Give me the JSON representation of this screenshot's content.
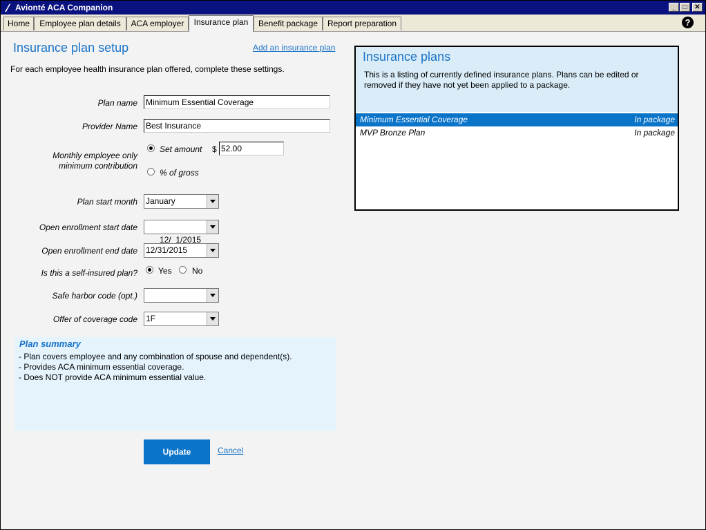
{
  "window": {
    "title": "Avionté ACA Companion",
    "minimize": "_",
    "maximize": "□",
    "close": "✕"
  },
  "tabs": [
    "Home",
    "Employee plan details",
    "ACA employer",
    "Insurance plan",
    "Benefit package",
    "Report preparation"
  ],
  "active_tab": "Insurance plan",
  "help": "?",
  "setup": {
    "title": "Insurance plan setup",
    "add_link": "Add an insurance plan",
    "intro": "For each employee health insurance plan offered, complete these settings."
  },
  "form": {
    "plan_name_label": "Plan name",
    "plan_name_value": "Minimum Essential Coverage",
    "provider_label": "Provider Name",
    "provider_value": "Best Insurance",
    "contribution_label_1": "Monthly employee only",
    "contribution_label_2": "minimum contribution",
    "set_amount_label": "Set amount",
    "currency": "$",
    "amount_value": "52.00",
    "percent_label": "% of gross",
    "start_month_label": "Plan start month",
    "start_month_value": "January",
    "oe_start_label": "Open enrollment start date",
    "oe_start_value": "12/  1/2015",
    "oe_end_label": "Open enrollment end date",
    "oe_end_value": "12/31/2015",
    "self_insured_label": "Is this a self-insured plan?",
    "yes_label": "Yes",
    "no_label": "No",
    "safe_harbor_label": "Safe harbor code (opt.)",
    "safe_harbor_value": "",
    "offer_code_label": "Offer of coverage code",
    "offer_code_value": "1F"
  },
  "summary": {
    "title": "Plan summary",
    "lines": [
      "- Plan covers employee and any combination of spouse and dependent(s).",
      "- Provides ACA minimum essential coverage.",
      "- Does NOT provide ACA minimum essential value."
    ]
  },
  "actions": {
    "update": "Update",
    "cancel": "Cancel"
  },
  "plans_panel": {
    "title": "Insurance plans",
    "description": "This is a listing of currently defined insurance plans. Plans can be edited or removed if they have not yet been applied to a package.",
    "plans": [
      {
        "name": "Minimum Essential Coverage",
        "status": "In package"
      },
      {
        "name": "MVP Bronze Plan",
        "status": "In package"
      }
    ]
  },
  "colors": {
    "title_bar": "#0a1280",
    "accent": "#1a73c7",
    "button": "#0a74c9",
    "summary_bg": "#e4f3fc",
    "panel_head_bg": "#d9ecf7"
  }
}
